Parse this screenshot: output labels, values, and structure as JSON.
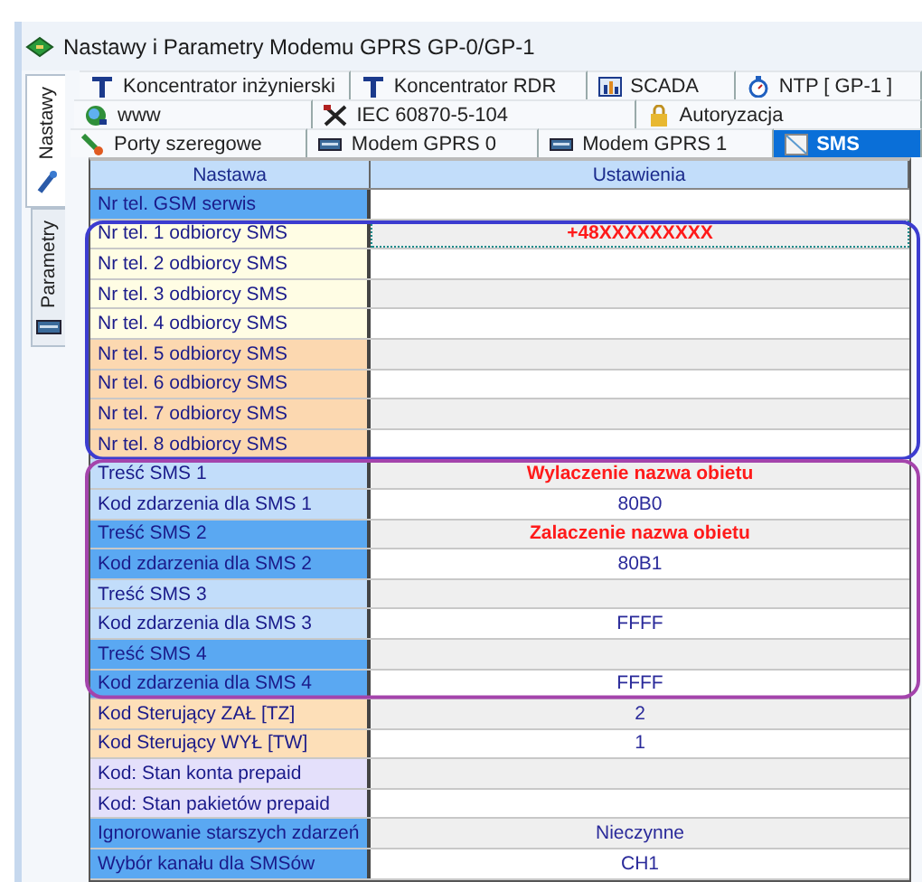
{
  "window": {
    "title": "Nastawy i Parametry Modemu GPRS GP-0/GP-1"
  },
  "side_tabs": [
    {
      "label": "Nastawy",
      "selected": true
    },
    {
      "label": "Parametry",
      "selected": false
    }
  ],
  "tab_rows": [
    [
      {
        "label": "Koncentrator inżynierski",
        "selected": false
      },
      {
        "label": "Koncentrator RDR",
        "selected": false
      },
      {
        "label": "SCADA",
        "selected": false
      },
      {
        "label": "NTP  [ GP-1 ]",
        "selected": false
      }
    ],
    [
      {
        "label": "www",
        "selected": false
      },
      {
        "label": "IEC 60870-5-104",
        "selected": false
      },
      {
        "label": "Autoryzacja",
        "selected": false
      }
    ],
    [
      {
        "label": "Porty szeregowe",
        "selected": false
      },
      {
        "label": "Modem GPRS 0",
        "selected": false
      },
      {
        "label": "Modem GPRS 1",
        "selected": false
      },
      {
        "label": "SMS",
        "selected": true
      }
    ]
  ],
  "table": {
    "columns": [
      "Nastawa",
      "Ustawienia"
    ],
    "sections": [
      {
        "rows": [
          {
            "name": "Nr tel. GSM serwis",
            "color": "#5aa8f2"
          }
        ]
      },
      {
        "color": "#3c3cd0",
        "rows": [
          {
            "name": "Nr tel. 1 odbiorcy SMS",
            "value": "+48XXXXXXXXX",
            "color": "#fffde4",
            "emphasis": true,
            "focused": true
          },
          {
            "name": "Nr tel. 2 odbiorcy SMS",
            "color": "#fffde4"
          },
          {
            "name": "Nr tel. 3 odbiorcy SMS",
            "color": "#fffde4"
          },
          {
            "name": "Nr tel. 4 odbiorcy SMS",
            "color": "#fffde4"
          },
          {
            "name": "Nr tel. 5 odbiorcy SMS",
            "color": "#fcd8b0"
          },
          {
            "name": "Nr tel. 6 odbiorcy SMS",
            "color": "#fcd8b0"
          },
          {
            "name": "Nr tel. 7 odbiorcy SMS",
            "color": "#fcd8b0"
          },
          {
            "name": "Nr tel. 8 odbiorcy SMS",
            "color": "#fcd8b0"
          }
        ]
      },
      {
        "color": "#a444ac",
        "rows": [
          {
            "name": "Treść SMS 1",
            "value": "Wylaczenie nazwa obietu",
            "color": "#c2ddfa",
            "emphasis": true,
            "focused": false
          },
          {
            "name": "Kod zdarzenia dla SMS 1",
            "value": "80B0",
            "color": "#c2ddfa",
            "emphasis": false,
            "focused": false
          },
          {
            "name": "Treść SMS 2",
            "value": "Zalaczenie  nazwa obietu",
            "color": "#5aa8f2",
            "emphasis": true,
            "focused": false
          },
          {
            "name": "Kod zdarzenia dla SMS 2",
            "value": "80B1",
            "color": "#5aa8f2",
            "emphasis": false,
            "focused": false
          },
          {
            "name": "Treść SMS 3",
            "color": "#c2ddfa"
          },
          {
            "name": "Kod zdarzenia dla SMS 3",
            "value": "FFFF",
            "color": "#c2ddfa",
            "emphasis": false,
            "focused": false
          },
          {
            "name": "Treść SMS 4",
            "color": "#5aa8f2"
          },
          {
            "name": "Kod zdarzenia dla SMS 4",
            "value": "FFFF",
            "color": "#5aa8f2",
            "emphasis": false,
            "focused": false
          }
        ]
      },
      {
        "rows": [
          {
            "name": "Kod Sterujący ZAŁ [TZ]",
            "value": "2",
            "color": "#fddfb8",
            "emphasis": false,
            "focused": false
          },
          {
            "name": "Kod Sterujący WYŁ [TW]",
            "value": "1",
            "color": "#fddfb8",
            "emphasis": false,
            "focused": false
          },
          {
            "name": "Kod: Stan konta prepaid",
            "color": "#e4e0fb"
          },
          {
            "name": "Kod: Stan pakietów prepaid",
            "color": "#e4e0fb"
          },
          {
            "name": "Ignorowanie starszych zdarzeń",
            "value": "Nieczynne",
            "color": "#5aa8f2",
            "emphasis": false,
            "focused": false
          },
          {
            "name": "Wybór kanału dla SMSów",
            "value": "CH1",
            "color": "#5aa8f2",
            "emphasis": false,
            "focused": false
          }
        ]
      }
    ]
  }
}
